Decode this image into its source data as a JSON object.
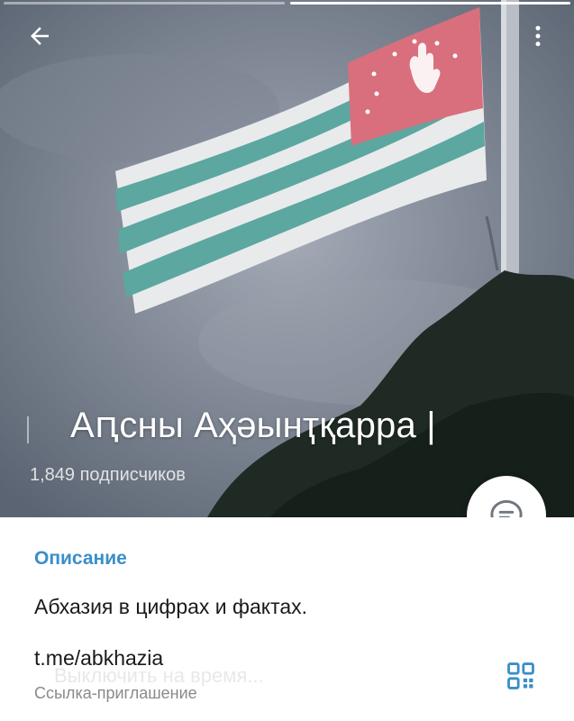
{
  "header": {
    "back_icon": "arrow-left-icon",
    "menu_icon": "more-vertical-icon",
    "story_bar_count": 2,
    "active_story_index": 1
  },
  "channel": {
    "title": "Аԥсны Аҳәынҭқарра |",
    "subscribers": "1,849 подписчиков"
  },
  "fab": {
    "icon": "chat-bubble-icon"
  },
  "info": {
    "description_header": "Описание",
    "description": "Абхазия в цифрах и фактах.",
    "link": "t.me/abkhazia",
    "link_caption": "Ссылка-приглашение",
    "ghost_text": "Выключить на время...",
    "qr_icon": "qr-code-icon"
  },
  "colors": {
    "accent": "#3a8fc9",
    "flag_green": "#5ca7a0",
    "flag_red": "#d96f7d"
  }
}
